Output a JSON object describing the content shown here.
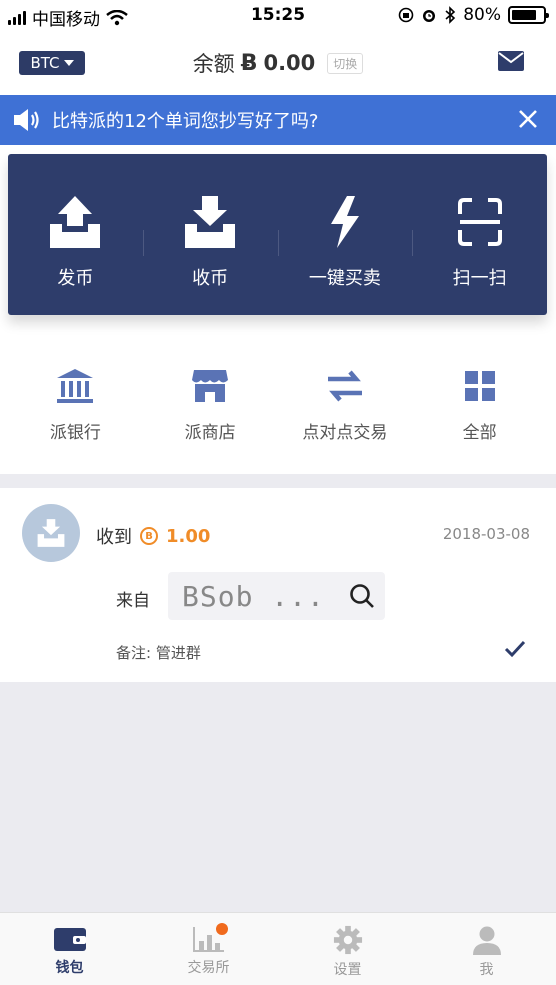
{
  "status_bar": {
    "carrier": "中国移动",
    "time": "15:25",
    "battery": "80%",
    "battery_level": 0.8
  },
  "header": {
    "coin": "BTC",
    "balance_label": "余额",
    "balance_symbol": "Ƀ",
    "balance_value": "0.00",
    "switch_label": "切换",
    "mail_icon": "mail-icon"
  },
  "notice": {
    "text": "比特派的12个单词您抄写好了吗?",
    "speaker_icon": "speaker-icon",
    "close_icon": "close-icon"
  },
  "actions": [
    {
      "label": "发币",
      "icon": "send-tray-icon"
    },
    {
      "label": "收币",
      "icon": "receive-tray-icon"
    },
    {
      "label": "一键买卖",
      "icon": "lightning-icon"
    },
    {
      "label": "扫一扫",
      "icon": "scan-icon"
    }
  ],
  "features": [
    {
      "label": "派银行",
      "icon": "bank-icon"
    },
    {
      "label": "派商店",
      "icon": "store-icon"
    },
    {
      "label": "点对点交易",
      "icon": "exchange-arrows-icon"
    },
    {
      "label": "全部",
      "icon": "grid-icon"
    }
  ],
  "transaction": {
    "type_label": "收到",
    "coin_symbol": "B",
    "amount": "1.00",
    "date": "2018-03-08",
    "from_label": "来自",
    "address": "BSob ...",
    "memo": "备注: 管进群"
  },
  "tabbar": [
    {
      "label": "钱包",
      "icon": "wallet-icon",
      "active": true
    },
    {
      "label": "交易所",
      "icon": "chart-icon",
      "badge": true
    },
    {
      "label": "设置",
      "icon": "gear-icon"
    },
    {
      "label": "我",
      "icon": "user-icon"
    }
  ],
  "colors": {
    "navy": "#2e3d6b",
    "banner_blue": "#3f71d5",
    "orange": "#f08c28",
    "icon_blue": "#5a73b5"
  }
}
